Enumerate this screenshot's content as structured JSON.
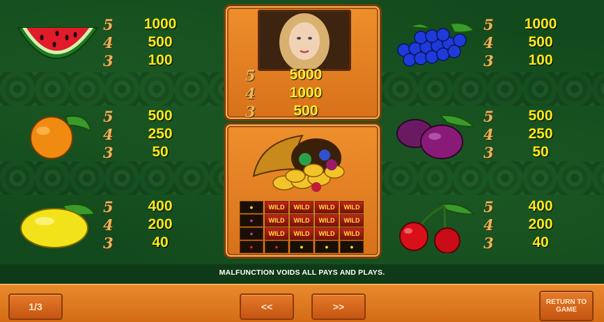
{
  "paytables": {
    "watermelon": [
      {
        "count": "5",
        "value": "1000"
      },
      {
        "count": "4",
        "value": "500"
      },
      {
        "count": "3",
        "value": "100"
      }
    ],
    "orange": [
      {
        "count": "5",
        "value": "500"
      },
      {
        "count": "4",
        "value": "250"
      },
      {
        "count": "3",
        "value": "50"
      }
    ],
    "lemon": [
      {
        "count": "5",
        "value": "400"
      },
      {
        "count": "4",
        "value": "200"
      },
      {
        "count": "3",
        "value": "40"
      }
    ],
    "grapes": [
      {
        "count": "5",
        "value": "1000"
      },
      {
        "count": "4",
        "value": "500"
      },
      {
        "count": "3",
        "value": "100"
      }
    ],
    "plum": [
      {
        "count": "5",
        "value": "500"
      },
      {
        "count": "4",
        "value": "250"
      },
      {
        "count": "3",
        "value": "50"
      }
    ],
    "cherry": [
      {
        "count": "5",
        "value": "400"
      },
      {
        "count": "4",
        "value": "200"
      },
      {
        "count": "3",
        "value": "40"
      }
    ],
    "lady": [
      {
        "count": "5",
        "value": "5000"
      },
      {
        "count": "4",
        "value": "1000"
      },
      {
        "count": "3",
        "value": "500"
      }
    ]
  },
  "wild_grid": {
    "label": "WILD",
    "cells": [
      "orange",
      "wild",
      "wild",
      "wild",
      "wild",
      "plum",
      "wild",
      "wild",
      "wild",
      "wild",
      "plum",
      "wild",
      "wild",
      "wild",
      "wild",
      "cherry",
      "cherry",
      "lemon",
      "lemon",
      "lemon"
    ]
  },
  "disclaimer": "MALFUNCTION VOIDS ALL PAYS AND PLAYS.",
  "footer": {
    "page_indicator": "1/3",
    "prev_label": "<<",
    "next_label": ">>",
    "return_label": "RETURN TO GAME"
  },
  "colors": {
    "background": "#134a1d",
    "panel": "#e8832a",
    "payout_text": "#ffe81a",
    "footer": "#d46c16"
  }
}
